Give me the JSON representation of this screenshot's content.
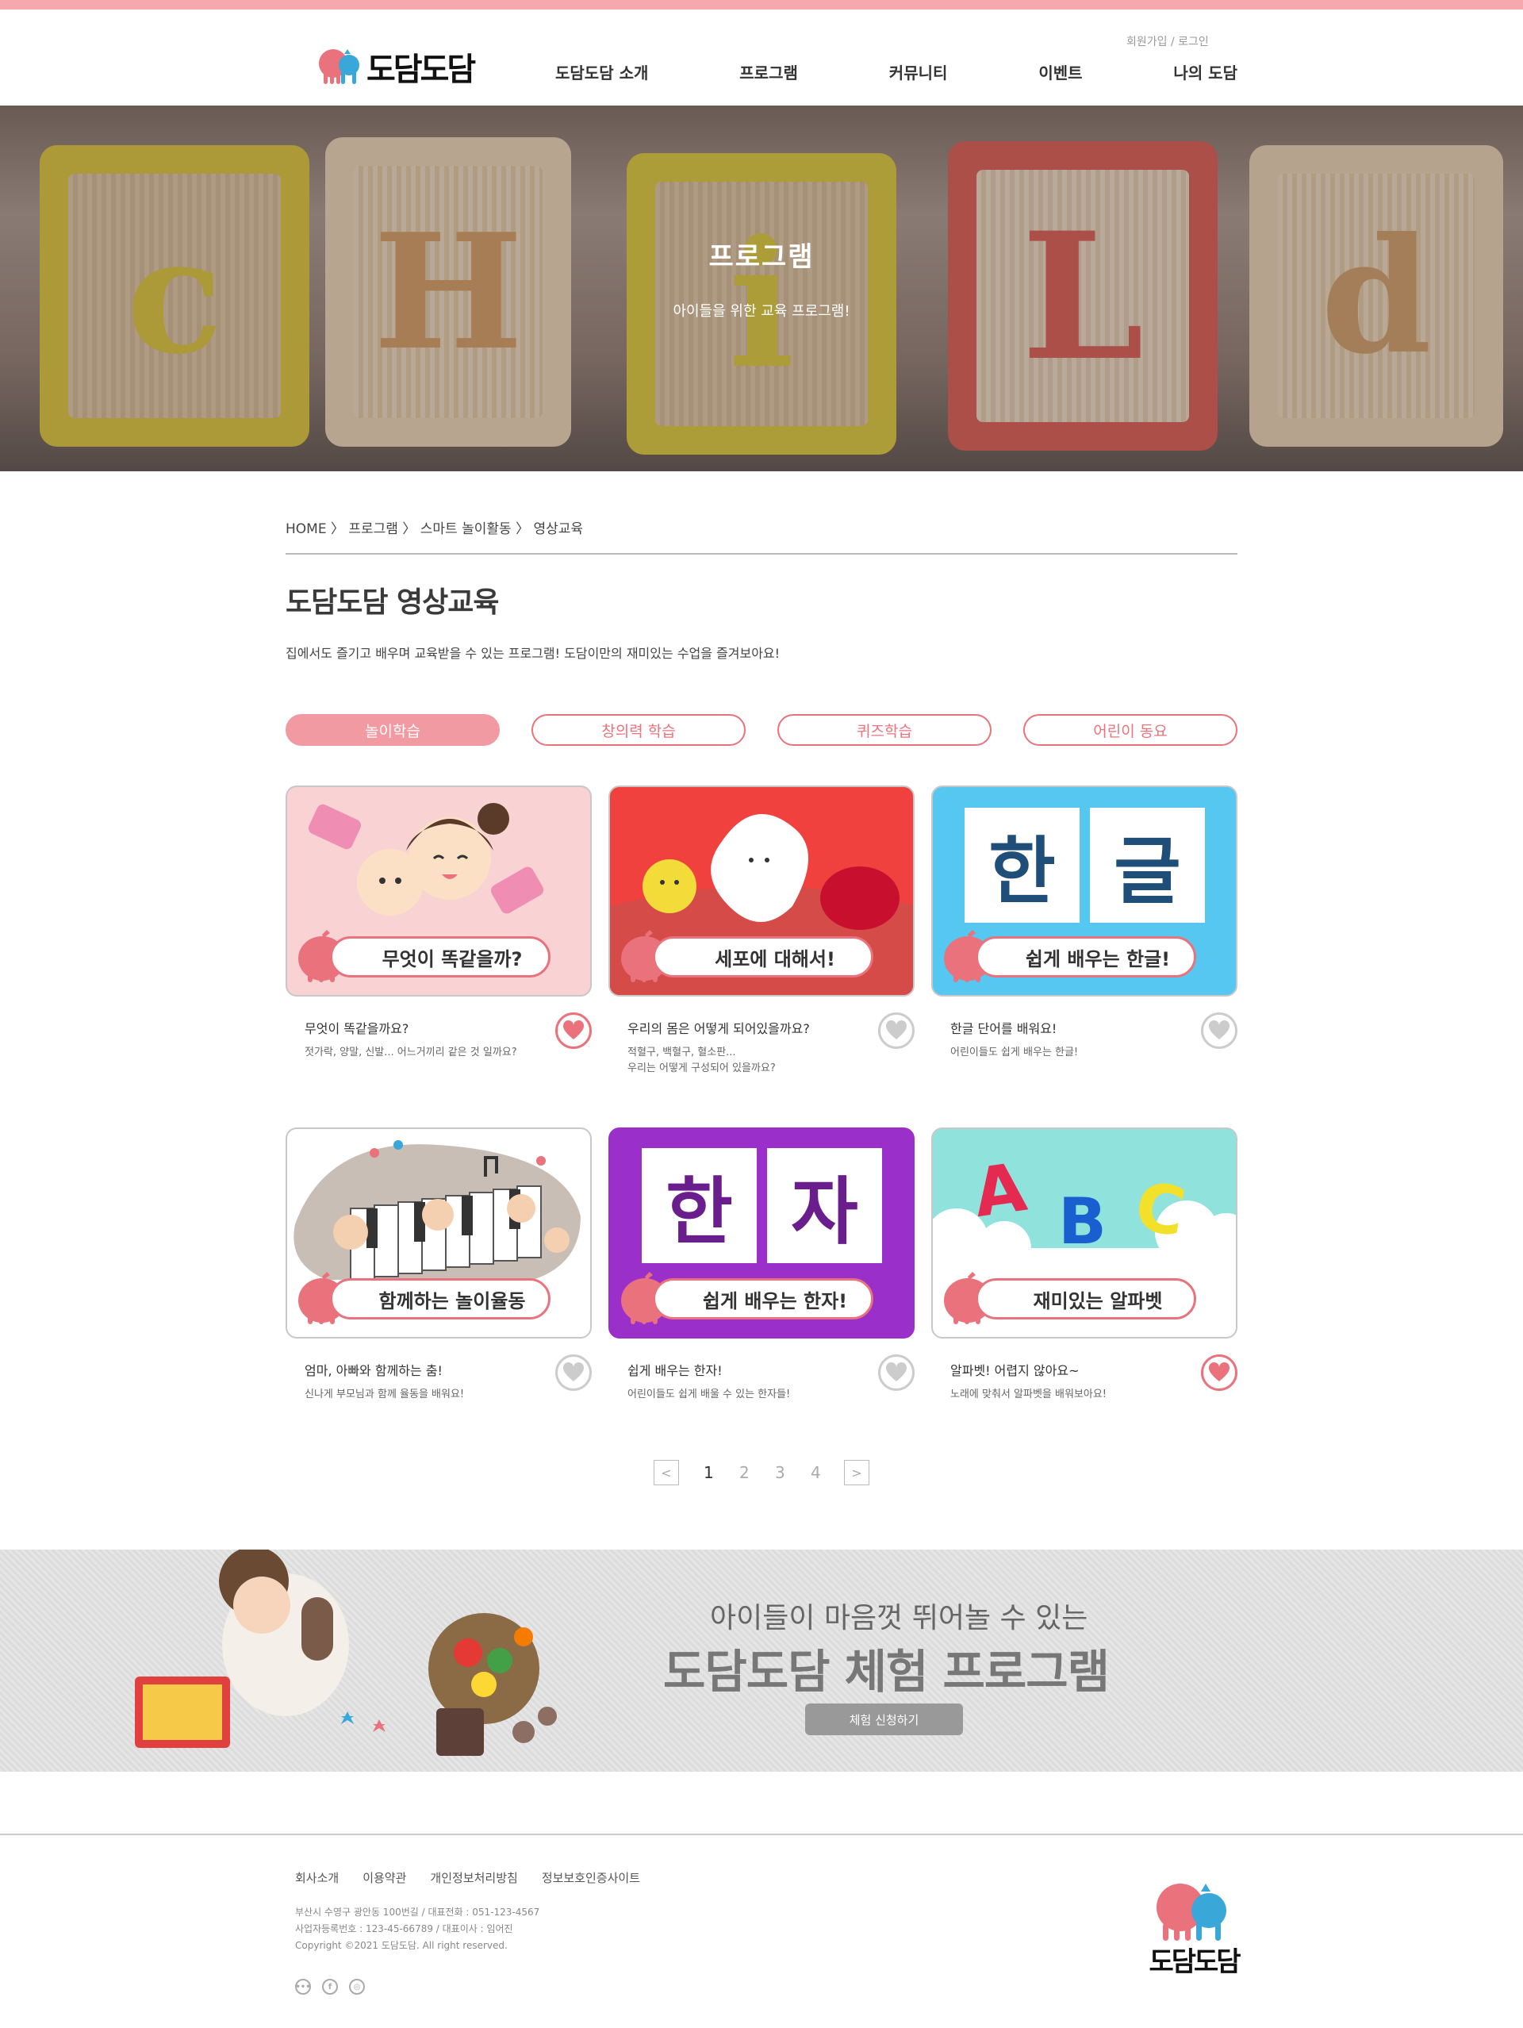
{
  "brand": {
    "logo_text": "도담도담",
    "accent": "#e9727c",
    "blue": "#3aa7d9"
  },
  "header": {
    "util": {
      "signup": "회원가입",
      "sep": " / ",
      "login": "로그인"
    },
    "nav": [
      "도담도담 소개",
      "프로그램",
      "커뮤니티",
      "이벤트",
      "나의 도담"
    ]
  },
  "hero": {
    "title": "프로그램",
    "subtitle": "아이들을 위한 교육 프로그램!",
    "blocks": [
      "c",
      "H",
      "i",
      "L",
      "d"
    ]
  },
  "breadcrumb": {
    "home": "HOME",
    "items": [
      "프로그램",
      "스마트 놀이활동",
      "영상교육"
    ],
    "sep": "〉"
  },
  "page": {
    "title": "도담도담 영상교육",
    "description": "집에서도 즐기고 배우며 교육받을 수 있는 프로그램! 도담이만의 재미있는 수업을 즐겨보아요!"
  },
  "tabs": [
    {
      "label": "놀이학습",
      "active": true
    },
    {
      "label": "창의력 학습",
      "active": false
    },
    {
      "label": "퀴즈학습",
      "active": false
    },
    {
      "label": "어린이 동요",
      "active": false
    }
  ],
  "cards": [
    {
      "badge": "무엇이 똑같을까?",
      "title": "무엇이 똑같을까요?",
      "text": "젓가락, 양말, 신발... 어느거끼리 같은 것 일까요?",
      "liked": true,
      "theme": "faces"
    },
    {
      "badge": "세포에 대해서!",
      "title": "우리의 몸은 어떻게 되어있을까요?",
      "text": "적혈구, 백혈구, 혈소판...\n우리는 어떻게 구성되어 있을까요?",
      "liked": false,
      "theme": "cells"
    },
    {
      "badge": "쉽게 배우는 한글!",
      "title": "한글 단어를 배워요!",
      "text": "어린이들도 쉽게 배우는 한글!",
      "liked": false,
      "theme": "hangul",
      "tiles": [
        "한",
        "글"
      ]
    },
    {
      "badge": "함께하는 놀이율동",
      "title": "엄마, 아빠와 함께하는 춤!",
      "text": "신나게 부모님과 함께 율동을 배워요!",
      "liked": false,
      "theme": "dance"
    },
    {
      "badge": "쉽게 배우는 한자!",
      "title": "쉽게 배우는 한자!",
      "text": "어린이들도 쉽게 배울 수 있는 한자들!",
      "liked": false,
      "theme": "hanja",
      "tiles": [
        "한",
        "자"
      ]
    },
    {
      "badge": "재미있는 알파벳",
      "title": "알파벳! 어렵지 않아요~",
      "text": "노래에 맞춰서 알파벳을 배워보아요!",
      "liked": true,
      "theme": "abc",
      "tiles": [
        "A",
        "B",
        "C"
      ]
    }
  ],
  "pagination": {
    "prev": "<",
    "next": ">",
    "pages": [
      "1",
      "2",
      "3",
      "4"
    ],
    "current": "1"
  },
  "banner": {
    "subtitle": "아이들이 마음껏 뛰어놀 수 있는",
    "title": "도담도담 체험 프로그램",
    "button": "체험 신청하기"
  },
  "footer": {
    "links": [
      "회사소개",
      "이용약관",
      "개인정보처리방침",
      "정보보호인증사이트"
    ],
    "address": "부산시 수영구 광안동 100번길 / 대표전화 : 051-123-4567",
    "business": "사업자등록번호 : 123-45-66789 /  대표이사 : 임어진",
    "copyright": "Copyright ©2021 도담도담. All right reserved.",
    "sns": [
      "kakao-icon",
      "facebook-icon",
      "instagram-icon"
    ]
  }
}
